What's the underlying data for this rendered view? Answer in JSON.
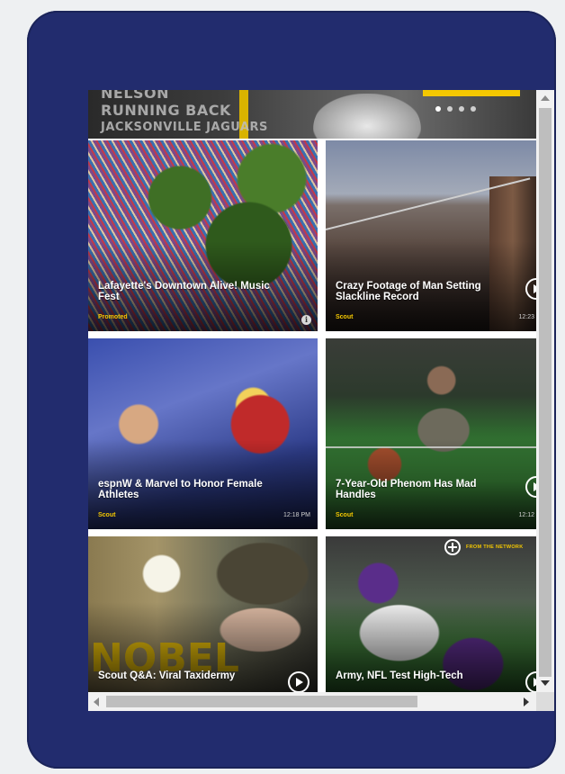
{
  "hero": {
    "ghost_lines": [
      "NELSON",
      "RUNNING BACK",
      "JACKSONVILLE JAGUARS"
    ],
    "carousel_dots": 4,
    "active_dot": 0
  },
  "tiles": [
    {
      "title": "Lafayette's Downtown Alive! Music Fest",
      "tag": "Promoted",
      "time": "",
      "icon": "info-icon"
    },
    {
      "title": "Crazy Footage of Man Setting Slackline Record",
      "tag": "Scout",
      "time": "12:23",
      "icon": "play-icon"
    },
    {
      "title": "espnW & Marvel to Honor Female Athletes",
      "tag": "Scout",
      "time": "12:18 PM",
      "icon": ""
    },
    {
      "title": "7-Year-Old Phenom Has Mad Handles",
      "tag": "Scout",
      "time": "12:12",
      "icon": "play-icon"
    },
    {
      "title": "Scout Q&A: Viral Taxidermy",
      "tag": "",
      "time": "",
      "icon": "play-icon"
    },
    {
      "title": "Army, NFL Test High-Tech",
      "tag": "",
      "time": "",
      "icon": "play-icon",
      "badge": "FROM THE NETWORK"
    }
  ],
  "colors": {
    "device": "#222c6e",
    "accent": "#f5c800"
  }
}
